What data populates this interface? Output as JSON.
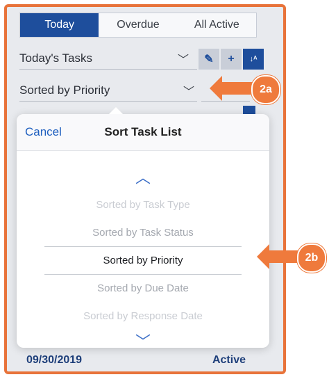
{
  "tabs": [
    {
      "label": "Today",
      "active": true
    },
    {
      "label": "Overdue",
      "active": false
    },
    {
      "label": "All Active",
      "active": false
    }
  ],
  "list_select": {
    "value": "Today's Tasks"
  },
  "sort_select": {
    "value": "Sorted by Priority"
  },
  "toolbar": {
    "edit_icon": "pencil-icon",
    "add_icon": "plus-icon",
    "sort_icon": "sort-az-icon",
    "sort_glyph": "↓ᴬ"
  },
  "bottom_row": {
    "date": "09/30/2019",
    "status": "Active"
  },
  "popover": {
    "cancel_label": "Cancel",
    "title": "Sort Task List",
    "options": [
      "Sorted by Task Type",
      "Sorted by Task Status",
      "Sorted by Priority",
      "Sorted by Due Date",
      "Sorted by Response Date"
    ],
    "selected": "Sorted by Priority"
  },
  "callouts": {
    "a": "2a",
    "b": "2b"
  },
  "colors": {
    "accent": "#1e4e9c",
    "callout": "#ef7a3c",
    "link": "#1f5fbf"
  }
}
